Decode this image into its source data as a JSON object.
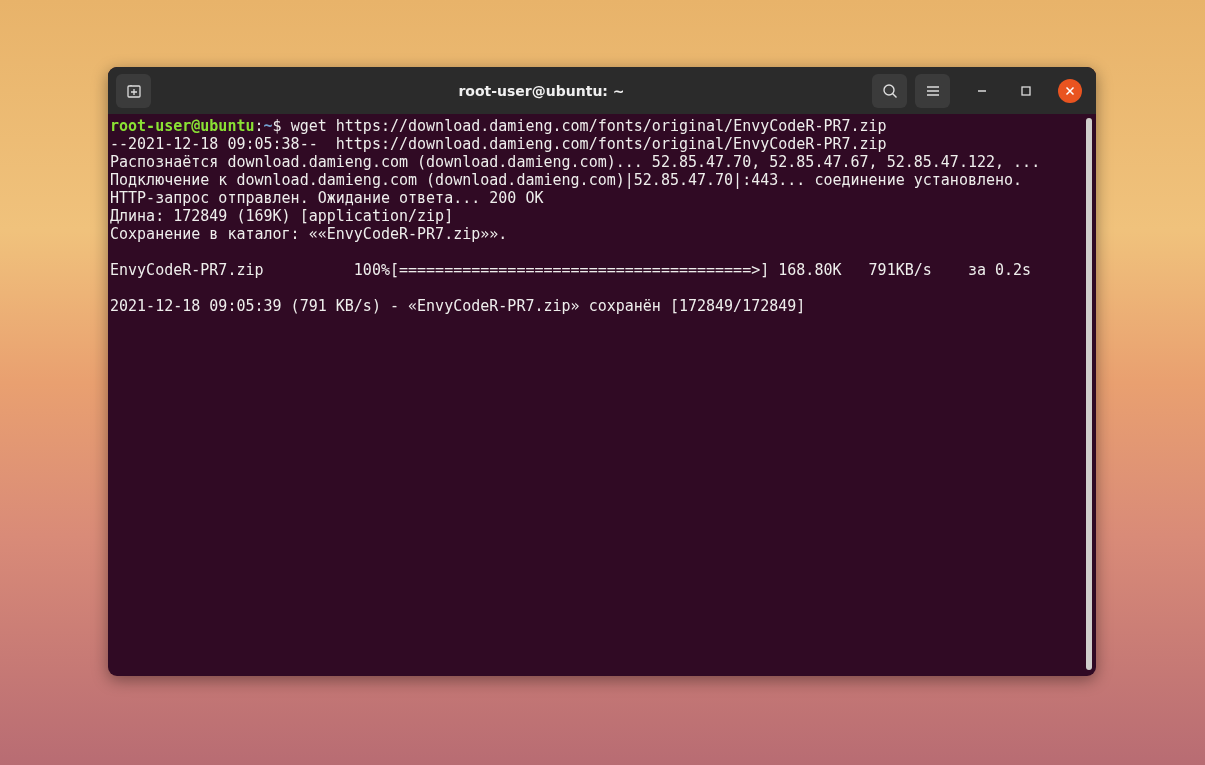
{
  "window": {
    "title": "root-user@ubuntu: ~"
  },
  "prompt": {
    "user_host": "root-user@ubuntu",
    "separator": ":",
    "path": "~",
    "symbol": "$",
    "command": "wget https://download.damieng.com/fonts/original/EnvyCodeR-PR7.zip"
  },
  "output_blocks": [
    [
      "--2021-12-18 09:05:38--  https://download.damieng.com/fonts/original/EnvyCodeR-PR7.zip",
      "Распознаётся download.damieng.com (download.damieng.com)... 52.85.47.70, 52.85.47.67, 52.85.47.122, ...",
      "Подключение к download.damieng.com (download.damieng.com)|52.85.47.70|:443... соединение установлено.",
      "HTTP-запрос отправлен. Ожидание ответа... 200 OK",
      "Длина: 172849 (169K) [application/zip]",
      "Сохранение в каталог: ««EnvyCodeR-PR7.zip»»."
    ],
    [
      "EnvyCodeR-PR7.zip          100%[=======================================>] 168.80K   791KB/s    за 0.2s"
    ],
    [
      "2021-12-18 09:05:39 (791 KB/s) - «EnvyCodeR-PR7.zip» сохранён [172849/172849]"
    ]
  ]
}
